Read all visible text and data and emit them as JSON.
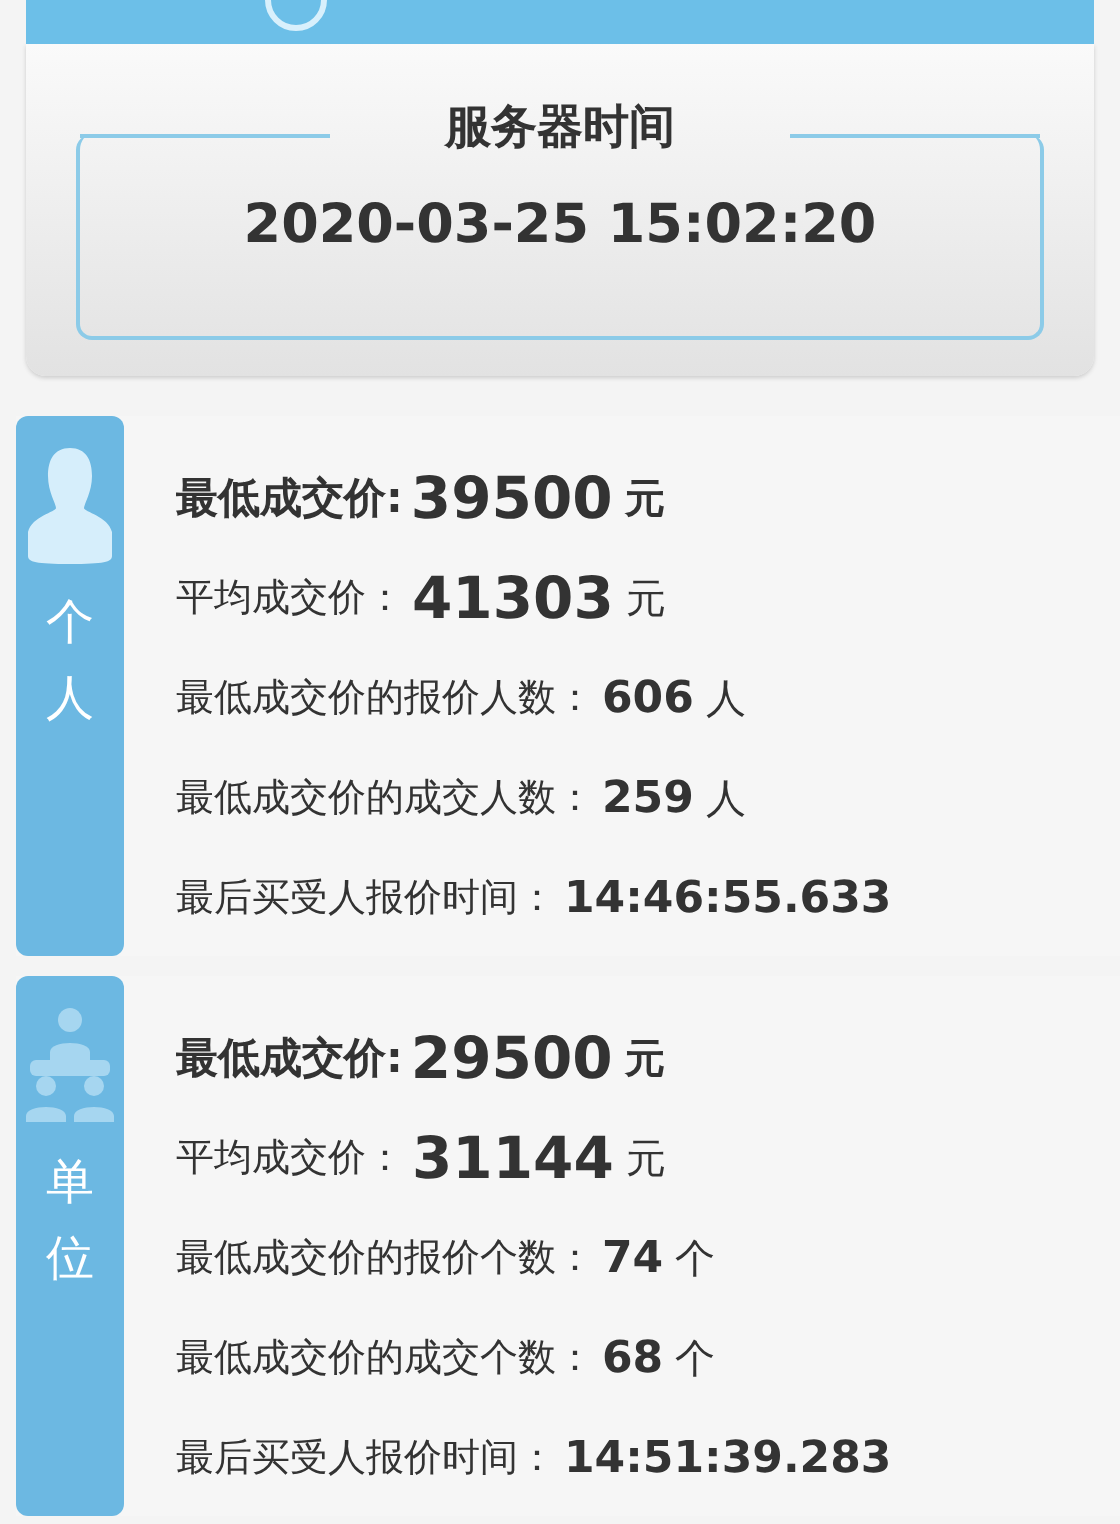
{
  "server_time": {
    "legend": "服务器时间",
    "value": "2020-03-25 15:02:20"
  },
  "groups": [
    {
      "kind": "person",
      "label": "个人",
      "rows": [
        {
          "kind": "primary",
          "label": "最低成交价:",
          "value": "39500",
          "unit": "元"
        },
        {
          "kind": "secondary",
          "label": "平均成交价：",
          "value": "41303",
          "unit": "元"
        },
        {
          "kind": "detail",
          "label": "最低成交价的报价人数：",
          "value": "606",
          "unit": "人"
        },
        {
          "kind": "detail",
          "label": "最低成交价的成交人数：",
          "value": "259",
          "unit": "人"
        },
        {
          "kind": "detail",
          "label": "最后买受人报价时间：",
          "value": "14:46:55.633"
        }
      ]
    },
    {
      "kind": "organization",
      "label": "单位",
      "rows": [
        {
          "kind": "primary",
          "label": "最低成交价:",
          "value": "29500",
          "unit": "元"
        },
        {
          "kind": "secondary",
          "label": "平均成交价：",
          "value": "31144",
          "unit": "元"
        },
        {
          "kind": "detail",
          "label": "最低成交价的报价个数：",
          "value": "74",
          "unit": "个"
        },
        {
          "kind": "detail",
          "label": "最低成交价的成交个数：",
          "value": "68",
          "unit": "个"
        },
        {
          "kind": "detail",
          "label": "最后买受人报价时间：",
          "value": "14:51:39.283"
        }
      ]
    }
  ]
}
